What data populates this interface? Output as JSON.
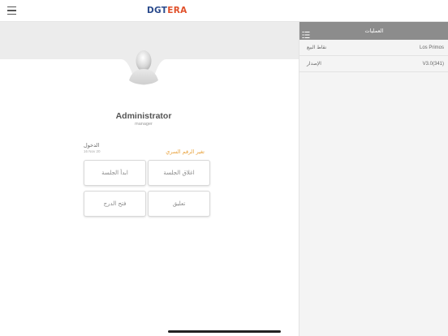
{
  "app": {
    "logo_part1": "DGT",
    "logo_part2": "ERA"
  },
  "profile": {
    "name": "Administrator",
    "role": "manager"
  },
  "session": {
    "login_label": "الدخول",
    "login_date": "16 Nov 20",
    "change_pin_label": "تغير الرقم السري",
    "start_session_label": "ابدأ الجلسة",
    "close_session_label": "اغلاق الجلسة",
    "open_drawer_label": "فتح الدرج",
    "suspend_label": "تعليق"
  },
  "side_panel": {
    "title": "العمليات",
    "rows": [
      {
        "label": "نقاط البيع",
        "value": "Los Primos"
      },
      {
        "label": "الإصدار",
        "value": "V3.0(341)"
      }
    ]
  },
  "colors": {
    "logo_blue": "#2a4a8c",
    "logo_orange": "#e0502a",
    "pin_link": "#e8a23c",
    "side_header": "#8c8c8c"
  },
  "icons": {
    "menu": "hamburger-menu-icon",
    "avatar": "user-avatar-icon",
    "list_settings": "list-settings-icon"
  }
}
